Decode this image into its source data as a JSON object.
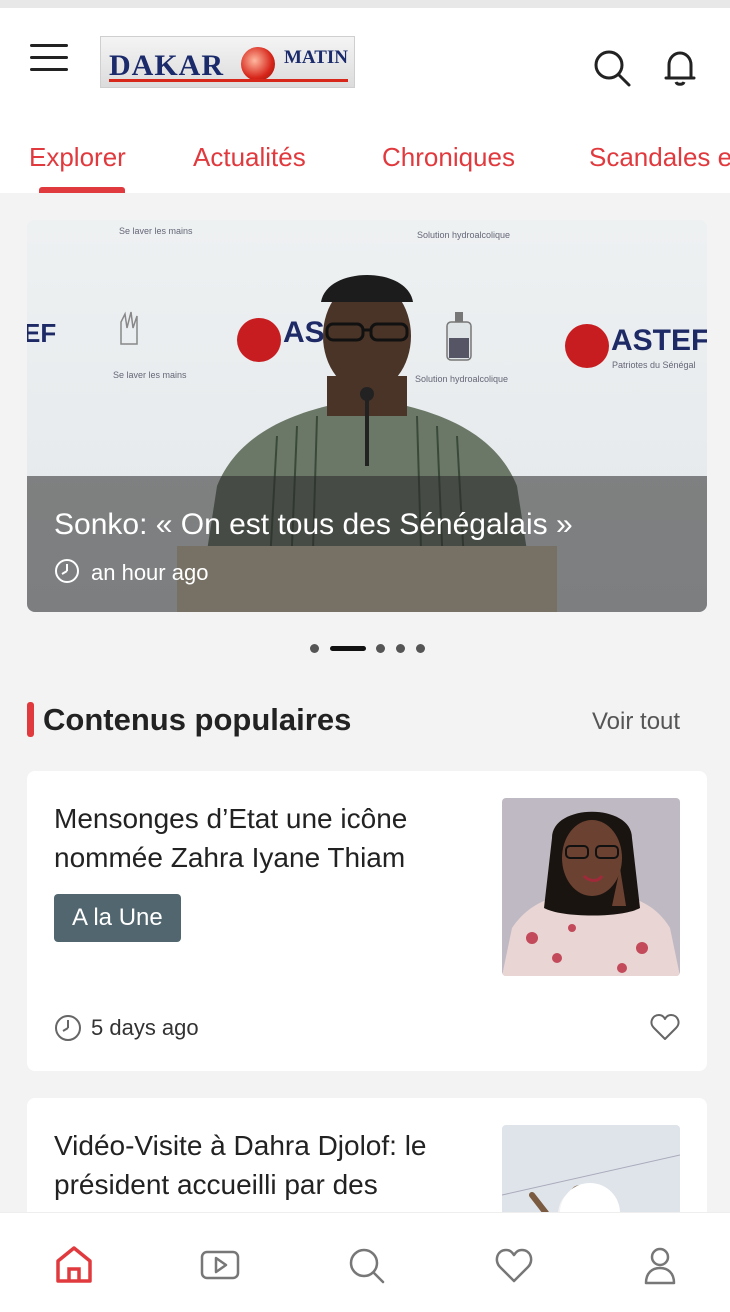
{
  "header": {
    "logo_main": "DAKAR",
    "logo_sub": "MATIN"
  },
  "tabs": [
    {
      "label": "Explorer"
    },
    {
      "label": "Actualités"
    },
    {
      "label": "Chroniques"
    },
    {
      "label": "Scandales et"
    }
  ],
  "carousel": {
    "title": "Sonko: « On est tous des Sénégalais »",
    "time": "an hour ago",
    "slide_count": 5,
    "active_index": 1,
    "image_texts": {
      "pastef": "ASTEF",
      "wash_hands": "Se laver les mains",
      "sanitizer": "Solution hydroalcolique",
      "patriotes": "Patriotes du Sénégal"
    }
  },
  "popular": {
    "title": "Contenus populaires",
    "see_all": "Voir tout",
    "items": [
      {
        "title": "Mensonges d’Etat une icône nommée Zahra Iyane Thiam",
        "tag": "A la Une",
        "time": "5 days ago"
      },
      {
        "title": "Vidéo-Visite à Dahra Djolof: le président accueilli par des"
      }
    ]
  },
  "colors": {
    "accent": "#e03a3e",
    "tag_bg": "#51666f"
  },
  "bottom_nav": [
    "home-icon",
    "video-icon",
    "search-icon",
    "heart-icon",
    "profile-icon"
  ]
}
